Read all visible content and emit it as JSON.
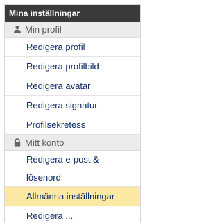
{
  "panel": {
    "title": "Mina inställningar"
  },
  "sections": [
    {
      "label": "Min profil",
      "icon": "user-icon",
      "items": [
        "Redigera profil",
        "Redigera profilbild",
        "Redigera avatar",
        "Redigera signatur",
        "Profilsekretess"
      ]
    },
    {
      "label": "Mitt konto",
      "icon": "lock-icon",
      "items": [
        "Redigera e-post &",
        "lösenord",
        "Allmänna inställningar",
        "Redigera ..."
      ]
    }
  ],
  "colors": {
    "header_bg": "#3a3a3a",
    "section_bg": "#ececec",
    "link": "#0a2a6b",
    "active_bg": "#fbe9a3"
  }
}
